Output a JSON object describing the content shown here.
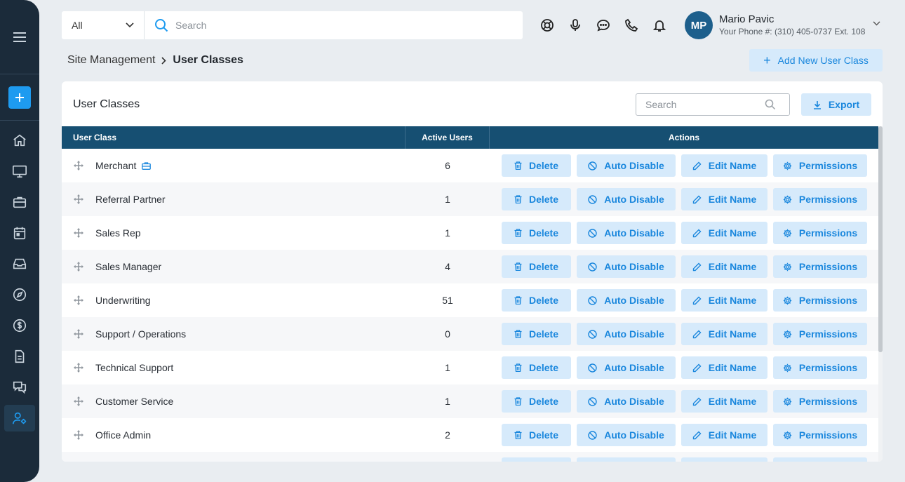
{
  "topbar": {
    "scope_value": "All",
    "search_placeholder": "Search",
    "user": {
      "initials": "MP",
      "name": "Mario Pavic",
      "phone": "Your Phone #: (310) 405-0737 Ext. 108"
    },
    "icons": [
      "lifebuoy-icon",
      "microphone-icon",
      "chat-icon",
      "phone-icon",
      "bell-icon"
    ]
  },
  "sidebar": {
    "items": [
      "home-icon",
      "monitor-icon",
      "briefcase-icon",
      "calendar-icon",
      "inbox-icon",
      "compass-icon",
      "dollar-icon",
      "document-icon",
      "messages-icon",
      "user-settings-icon"
    ],
    "active": "user-settings-icon"
  },
  "breadcrumb": {
    "parent": "Site Management",
    "current": "User Classes"
  },
  "add_button_label": "Add New User Class",
  "card": {
    "title": "User Classes",
    "search_placeholder": "Search",
    "export_label": "Export"
  },
  "table": {
    "columns": [
      "User Class",
      "Active Users",
      "Actions"
    ],
    "actions": {
      "delete": "Delete",
      "auto_disable": "Auto Disable",
      "edit_name": "Edit Name",
      "permissions": "Permissions"
    },
    "rows": [
      {
        "name": "Merchant",
        "active": "6",
        "badge": "briefcase-icon"
      },
      {
        "name": "Referral Partner",
        "active": "1"
      },
      {
        "name": "Sales Rep",
        "active": "1"
      },
      {
        "name": "Sales Manager",
        "active": "4"
      },
      {
        "name": "Underwriting",
        "active": "51"
      },
      {
        "name": "Support / Operations",
        "active": "0"
      },
      {
        "name": "Technical Support",
        "active": "1"
      },
      {
        "name": "Customer Service",
        "active": "1"
      },
      {
        "name": "Office Admin",
        "active": "2"
      }
    ]
  },
  "colors": {
    "sidebar": "#1b2b3a",
    "header": "#164f72",
    "accent": "#1a87dd",
    "button_bg": "#d6eafb"
  }
}
